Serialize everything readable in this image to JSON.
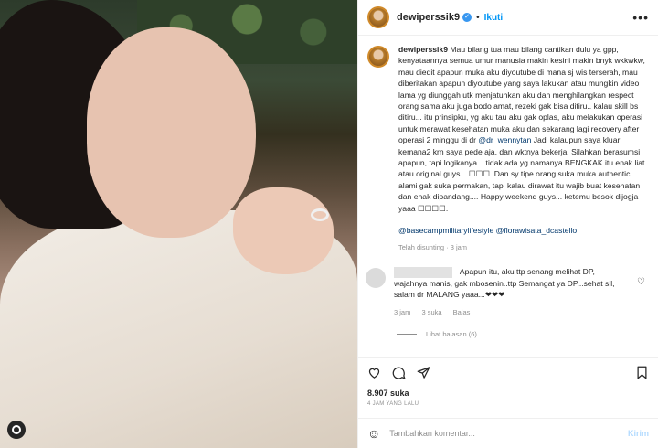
{
  "post": {
    "username": "dewiperssik9",
    "follow_label": "Ikuti",
    "more_icon": "•••"
  },
  "caption": {
    "username": "dewiperssik9",
    "text_1": "Mau bilang tua mau bilang cantikan dulu ya gpp, kenyataannya semua umur manusia makin kesini makin bnyk wkkwkw, mau diedit apapun muka aku diyoutube di mana sj wis terserah, mau diberitakan apapun diyoutube yang saya lakukan atau mungkin video lama yg diunggah utk menjatuhkan aku dan menghilangkan respect orang sama aku juga bodo amat, rezeki gak bisa ditiru.. kalau skill bs ditiru... itu prinsipku, yg aku tau aku gak oplas, aku melakukan operasi untuk merawat kesehatan muka aku dan sekarang lagi recovery after operasi 2 minggu di dr ",
    "mention_1": "@dr_wennytan",
    "text_2": " Jadi kalaupun saya kluar kemana2 krn saya pede aja, dan wktnya bekerja. Silahkan berasumsi apapun, tapi logikanya... tidak ada yg namanya BENGKAK itu enak liat atau original guys... ☐☐☐. Dan sy tipe orang suka muka authentic alami gak suka permakan, tapi kalau dirawat itu wajib buat kesehatan dan enak dipandang.... Happy weekend guys... ketemu besok dijogja yaaa ☐☐☐☐.",
    "tag_1": "@basecampmilitarylifestyle",
    "tag_2": "@florawisata_dcastello",
    "edited": "Telah disunting · 3 jam"
  },
  "comment": {
    "text": "Apapun itu, aku ttp senang melihat DP, wajahnya manis, gak mbosenin..ttp Semangat ya DP...sehat sll, salam dr MALANG yaaa...❤❤❤",
    "time": "3 jam",
    "likes": "3 suka",
    "reply": "Balas",
    "view_replies": "Lihat balasan (6)"
  },
  "actions": {
    "likes": "8.907 suka",
    "time_ago": "4 JAM YANG LALU"
  },
  "comment_input": {
    "placeholder": "Tambahkan komentar...",
    "post_label": "Kirim"
  }
}
